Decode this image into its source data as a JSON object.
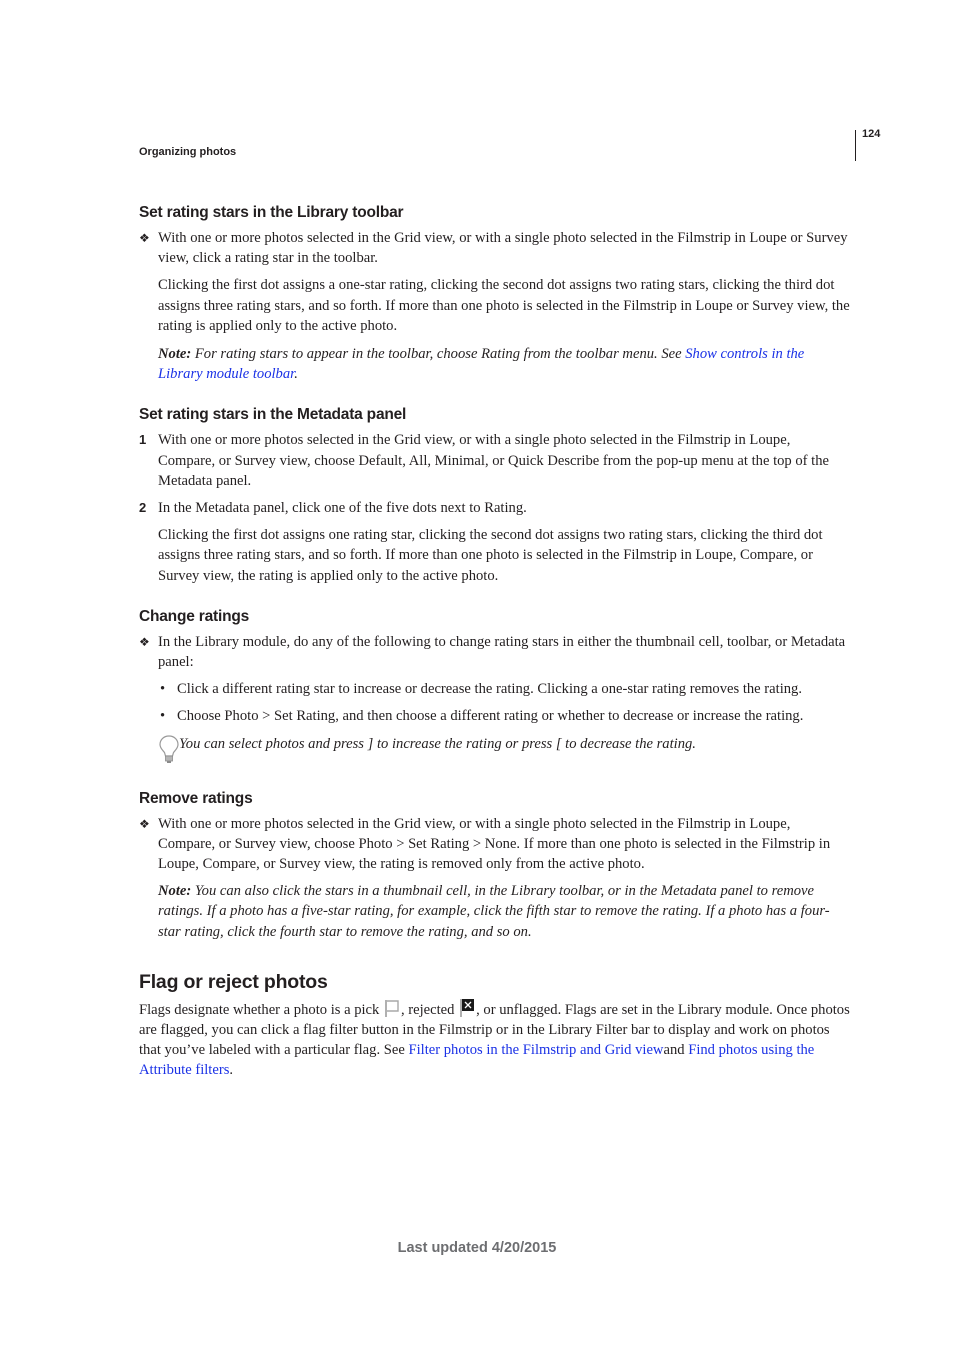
{
  "header": {
    "running_head": "Organizing photos",
    "page_number": "124"
  },
  "sections": {
    "library_toolbar": {
      "heading": "Set rating stars in the Library toolbar",
      "step": "With one or more photos selected in the Grid view, or with a single photo selected in the Filmstrip in Loupe or Survey view, click a rating star in the toolbar.",
      "detail": "Clicking the first dot assigns a one-star rating, clicking the second dot assigns two rating stars, clicking the third dot assigns three rating stars, and so forth. If more than one photo is selected in the Filmstrip in Loupe or Survey view, the rating is applied only to the active photo.",
      "note_label": "Note:",
      "note_text": " For rating stars to appear in the toolbar, choose Rating from the toolbar menu. See ",
      "note_link": "Show controls in the Library module toolbar",
      "note_end": "."
    },
    "metadata_panel": {
      "heading": "Set rating stars in the Metadata panel",
      "steps": [
        {
          "num": "1",
          "text": "With one or more photos selected in the Grid view, or with a single photo selected in the Filmstrip in Loupe, Compare, or Survey view, choose Default, All, Minimal, or Quick Describe from the pop-up menu at the top of the Metadata panel."
        },
        {
          "num": "2",
          "text": "In the Metadata panel, click one of the five dots next to Rating."
        }
      ],
      "detail": "Clicking the first dot assigns one rating star, clicking the second dot assigns two rating stars, clicking the third dot assigns three rating stars, and so forth. If more than one photo is selected in the Filmstrip in Loupe, Compare, or Survey view, the rating is applied only to the active photo."
    },
    "change_ratings": {
      "heading": "Change ratings",
      "step": "In the Library module, do any of the following to change rating stars in either the thumbnail cell, toolbar, or Metadata panel:",
      "bullets": [
        "Click a different rating star to increase or decrease the rating. Clicking a one-star rating removes the rating.",
        "Choose Photo > Set Rating, and then choose a different rating or whether to decrease or increase the rating."
      ],
      "tip": "You can select photos and press ] to increase the rating or press [ to decrease the rating."
    },
    "remove_ratings": {
      "heading": "Remove ratings",
      "step": "With one or more photos selected in the Grid view, or with a single photo selected in the Filmstrip in Loupe, Compare, or Survey view, choose Photo > Set Rating > None. If more than one photo is selected in the Filmstrip in Loupe, Compare, or Survey view, the rating is removed only from the active photo.",
      "note_label": "Note:",
      "note_text": " You can also click the stars in a thumbnail cell, in the Library toolbar, or in the Metadata panel to remove ratings. If a photo has a five-star rating, for example, click the fifth star to remove the rating. If a photo has a four-star rating, click the fourth star to remove the rating, and so on."
    },
    "flag_reject": {
      "heading": "Flag or reject photos",
      "text_1": "Flags designate whether a photo is a pick ",
      "text_2": ", rejected ",
      "text_3": ", or unflagged. Flags are set in the Library module. Once photos are flagged, you can click a flag filter button in the Filmstrip or in the Library Filter bar to display and work on photos that you’ve labeled with a particular flag. See ",
      "link_1": "Filter photos in the Filmstrip and Grid view",
      "text_4": "and ",
      "link_2": "Find photos using the Attribute filters",
      "text_5": "."
    }
  },
  "markers": {
    "diamond": "❖",
    "bullet": "•"
  },
  "colors": {
    "link": "#1a31e6",
    "text": "#231f20",
    "footer": "#6d6e71"
  },
  "footer": {
    "text": "Last updated 4/20/2015"
  }
}
